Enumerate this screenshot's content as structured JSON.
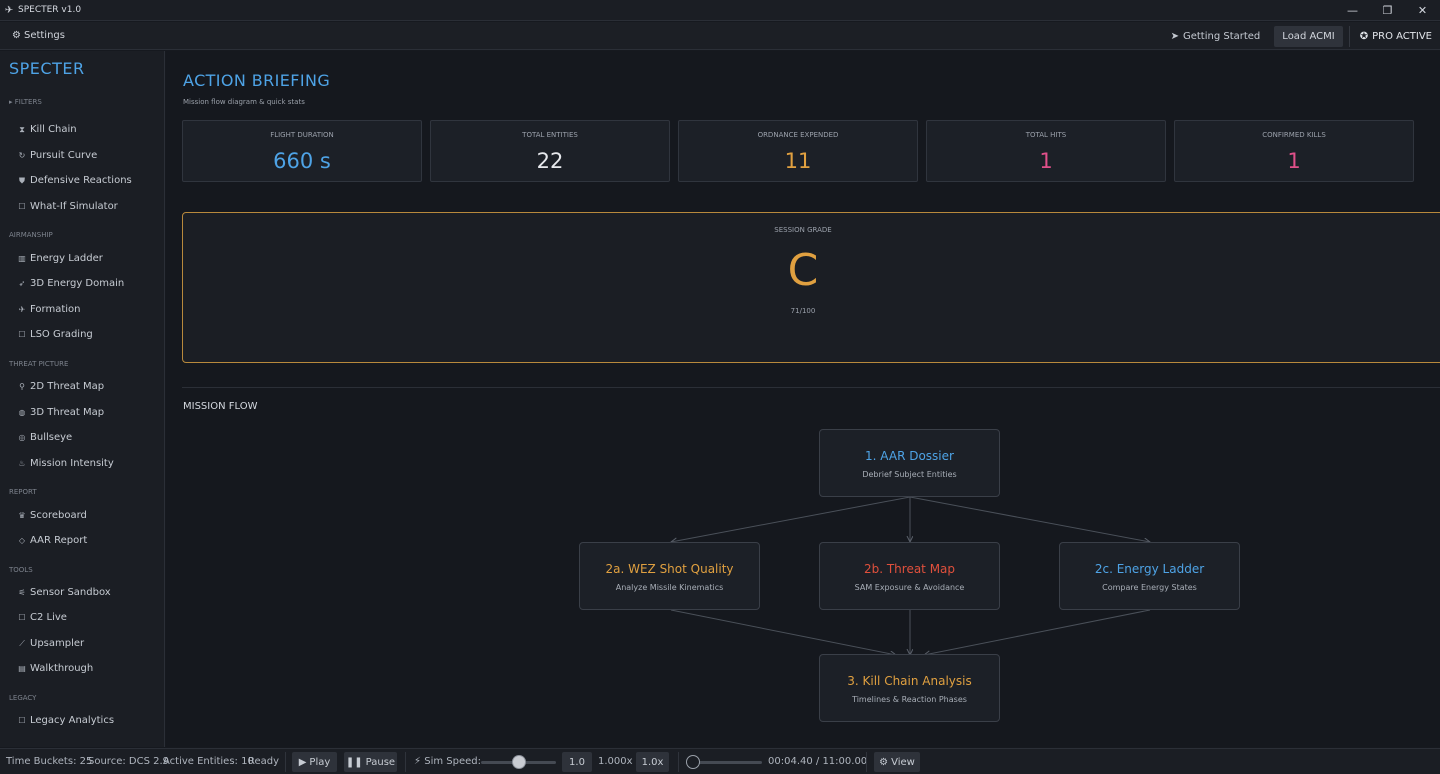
{
  "window": {
    "title": "SPECTER v1.0"
  },
  "menubar": {
    "settings_label": "Settings",
    "getting_started_label": "Getting Started",
    "load_acmi_label": "Load ACMI",
    "pro_active_label": "PRO ACTIVE"
  },
  "sidebar": {
    "brand": "SPECTER",
    "sections": [
      {
        "label": "FILTERS",
        "items": [
          {
            "label": "Kill Chain",
            "icon": "hourglass-icon"
          },
          {
            "label": "Pursuit Curve",
            "icon": "refresh-icon"
          },
          {
            "label": "Defensive Reactions",
            "icon": "shield-icon"
          },
          {
            "label": "What-If Simulator",
            "icon": "square-icon"
          }
        ]
      },
      {
        "label": "AIRMANSHIP",
        "items": [
          {
            "label": "Energy Ladder",
            "icon": "bar-chart-icon"
          },
          {
            "label": "3D Energy Domain",
            "icon": "rocket-icon"
          },
          {
            "label": "Formation",
            "icon": "plane-icon"
          },
          {
            "label": "LSO Grading",
            "icon": "square-icon"
          }
        ]
      },
      {
        "label": "THREAT PICTURE",
        "items": [
          {
            "label": "2D Threat Map",
            "icon": "pin-icon"
          },
          {
            "label": "3D Threat Map",
            "icon": "globe-icon"
          },
          {
            "label": "Bullseye",
            "icon": "target-icon"
          },
          {
            "label": "Mission Intensity",
            "icon": "flame-icon"
          }
        ]
      },
      {
        "label": "REPORT",
        "items": [
          {
            "label": "Scoreboard",
            "icon": "trophy-icon"
          },
          {
            "label": "AAR Report",
            "icon": "tag-icon"
          }
        ]
      },
      {
        "label": "TOOLS",
        "items": [
          {
            "label": "Sensor Sandbox",
            "icon": "satellite-icon"
          },
          {
            "label": "C2 Live",
            "icon": "square-icon"
          },
          {
            "label": "Upsampler",
            "icon": "line-chart-icon"
          },
          {
            "label": "Walkthrough",
            "icon": "book-icon"
          }
        ]
      },
      {
        "label": "LEGACY",
        "items": [
          {
            "label": "Legacy Analytics",
            "icon": "square-icon"
          }
        ]
      }
    ]
  },
  "main": {
    "title": "ACTION BRIEFING",
    "subtitle": "Mission flow diagram & quick stats",
    "stats": [
      {
        "label": "FLIGHT DURATION",
        "value": "660 s",
        "color": "#4ea3e6"
      },
      {
        "label": "TOTAL ENTITIES",
        "value": "22",
        "color": "#e6e8ec"
      },
      {
        "label": "ORDNANCE EXPENDED",
        "value": "11",
        "color": "#e0a040"
      },
      {
        "label": "TOTAL HITS",
        "value": "1",
        "color": "#e0508a"
      },
      {
        "label": "CONFIRMED KILLS",
        "value": "1",
        "color": "#e0508a"
      }
    ],
    "grade": {
      "label": "SESSION GRADE",
      "value": "C",
      "score": "71/100",
      "color": "#e0a040"
    },
    "flow_title": "MISSION FLOW",
    "flow_nodes": [
      {
        "title": "1. AAR Dossier",
        "sub": "Debrief Subject Entities",
        "color": "#4ea3e6"
      },
      {
        "title": "2a. WEZ Shot Quality",
        "sub": "Analyze Missile Kinematics",
        "color": "#e0a040"
      },
      {
        "title": "2b. Threat Map",
        "sub": "SAM Exposure & Avoidance",
        "color": "#e0503c"
      },
      {
        "title": "2c. Energy Ladder",
        "sub": "Compare Energy States",
        "color": "#4ea3e6"
      },
      {
        "title": "3. Kill Chain Analysis",
        "sub": "Timelines & Reaction Phases",
        "color": "#e0a040"
      }
    ]
  },
  "statusbar": {
    "time_buckets": "Time Buckets: 25",
    "source": "Source: DCS 2.9",
    "active_entities": "Active Entities: 10",
    "status": "Ready",
    "play_label": "Play",
    "pause_label": "Pause",
    "sim_speed_label": "Sim Speed:",
    "sim_speed_value": 0.5,
    "speed_box": "1.0",
    "speed_readout": "1.000x",
    "speed_preset": "1.0x",
    "timeline_progress": 0.0067,
    "time_readout": "00:04.40 / 11:00.00",
    "view_label": "View"
  }
}
